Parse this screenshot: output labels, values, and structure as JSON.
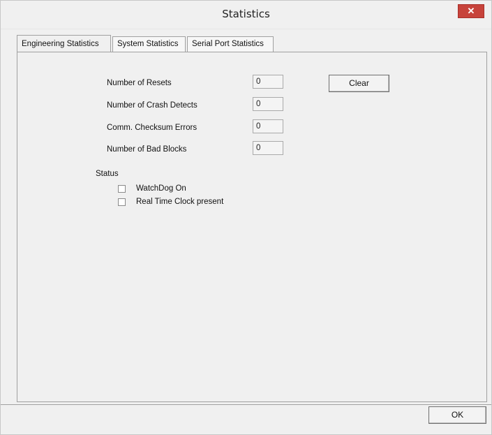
{
  "window": {
    "title": "Statistics",
    "close_glyph": "✕"
  },
  "tabs": [
    {
      "label": "Engineering Statistics",
      "active": true
    },
    {
      "label": "System Statistics",
      "active": false
    },
    {
      "label": "Serial Port Statistics",
      "active": false
    }
  ],
  "engineering": {
    "rows": [
      {
        "label": "Number of Resets",
        "value": "0"
      },
      {
        "label": "Number of Crash Detects",
        "value": "0"
      },
      {
        "label": "Comm. Checksum Errors",
        "value": "0"
      },
      {
        "label": "Number of Bad Blocks",
        "value": "0"
      }
    ],
    "clear_label": "Clear",
    "status_heading": "Status",
    "checks": [
      {
        "label": "WatchDog On",
        "checked": false
      },
      {
        "label": "Real Time Clock present",
        "checked": false
      }
    ]
  },
  "footer": {
    "ok_label": "OK"
  }
}
